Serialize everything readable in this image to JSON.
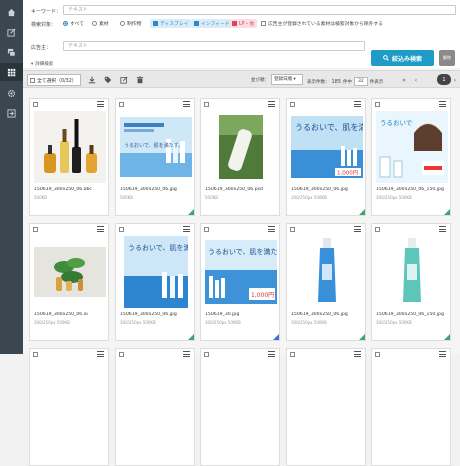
{
  "search": {
    "keyword_label": "キーワード：",
    "keyword_placeholder": "テキスト",
    "target_label": "検索対象：",
    "targets": [
      {
        "label": "すべて",
        "checked": true
      },
      {
        "label": "素材",
        "checked": false
      },
      {
        "label": "制作物",
        "checked": false
      }
    ],
    "tags": [
      {
        "label": "ディスプレイ",
        "checked": true
      },
      {
        "label": "インフィード",
        "checked": true
      },
      {
        "label": "LP・他",
        "checked": true
      }
    ],
    "ad_only_label": "広告主が登録されている素材は検索対象から除外する",
    "advertiser_label": "広告主：",
    "advertiser_placeholder": "テキスト",
    "search_button": "絞込み検索",
    "clear_button": "解除",
    "detail_toggle": "詳細検索"
  },
  "toolbar": {
    "select_all_label": "全て選択（0/32）",
    "sort_label": "並び順：",
    "sort_value": "登録日順",
    "display_label": "表示件数：",
    "total_count": "185",
    "total_unit": "件中",
    "per_page": "32",
    "per_page_unit": "件表示",
    "current_page": "1"
  },
  "cards": [
    {
      "name": "150619_300x250_06.abc",
      "meta": "500KB",
      "thumb": "bottles",
      "corner": ""
    },
    {
      "name": "150619_300x250_06.jpg",
      "meta": "500KB",
      "thumb": "banner-blue",
      "corner": "#3aa86b"
    },
    {
      "name": "150619_300x250_06.psd",
      "meta": "500KB",
      "thumb": "bottle-green",
      "corner": ""
    },
    {
      "name": "150619_300x250_06.jpg",
      "meta": "300/250px 500KB",
      "thumb": "banner-sea",
      "corner": "#3aa86b"
    },
    {
      "name": "150619_300x250_06_150.jpg",
      "meta": "300/250px 500KB",
      "thumb": "banner-woman",
      "corner": "#3aa86b"
    },
    {
      "name": "150619_300x250_06.ai",
      "meta": "300/250px 500KB",
      "thumb": "plant",
      "corner": ""
    },
    {
      "name": "150619_300x250_06.jpg",
      "meta": "300/250px 500KB",
      "thumb": "banner-sea2",
      "corner": "#3aa86b"
    },
    {
      "name": "150619_30.jpg",
      "meta": "300/250px 500KB",
      "thumb": "banner-sea3",
      "corner": "#3a6fd0"
    },
    {
      "name": "150619_300x250_06.jpg",
      "meta": "300/250px 500KB",
      "thumb": "bottle-blue",
      "corner": "#3aa86b"
    },
    {
      "name": "150619_300x250_06_150.jpg",
      "meta": "300/250px 500KB",
      "thumb": "bottle-teal",
      "corner": "#3aa86b"
    }
  ],
  "banner_texts": {
    "blue_headline": "うるおいで、肌を満たす。",
    "sea_headline": "うるおいで、肌を満たす。",
    "price": "1,000円",
    "woman_headline": "うるおいで"
  },
  "icons": {
    "sidebar": [
      "home-icon",
      "edit-icon",
      "chat-icon",
      "grid-icon",
      "gear-icon",
      "export-icon"
    ]
  }
}
